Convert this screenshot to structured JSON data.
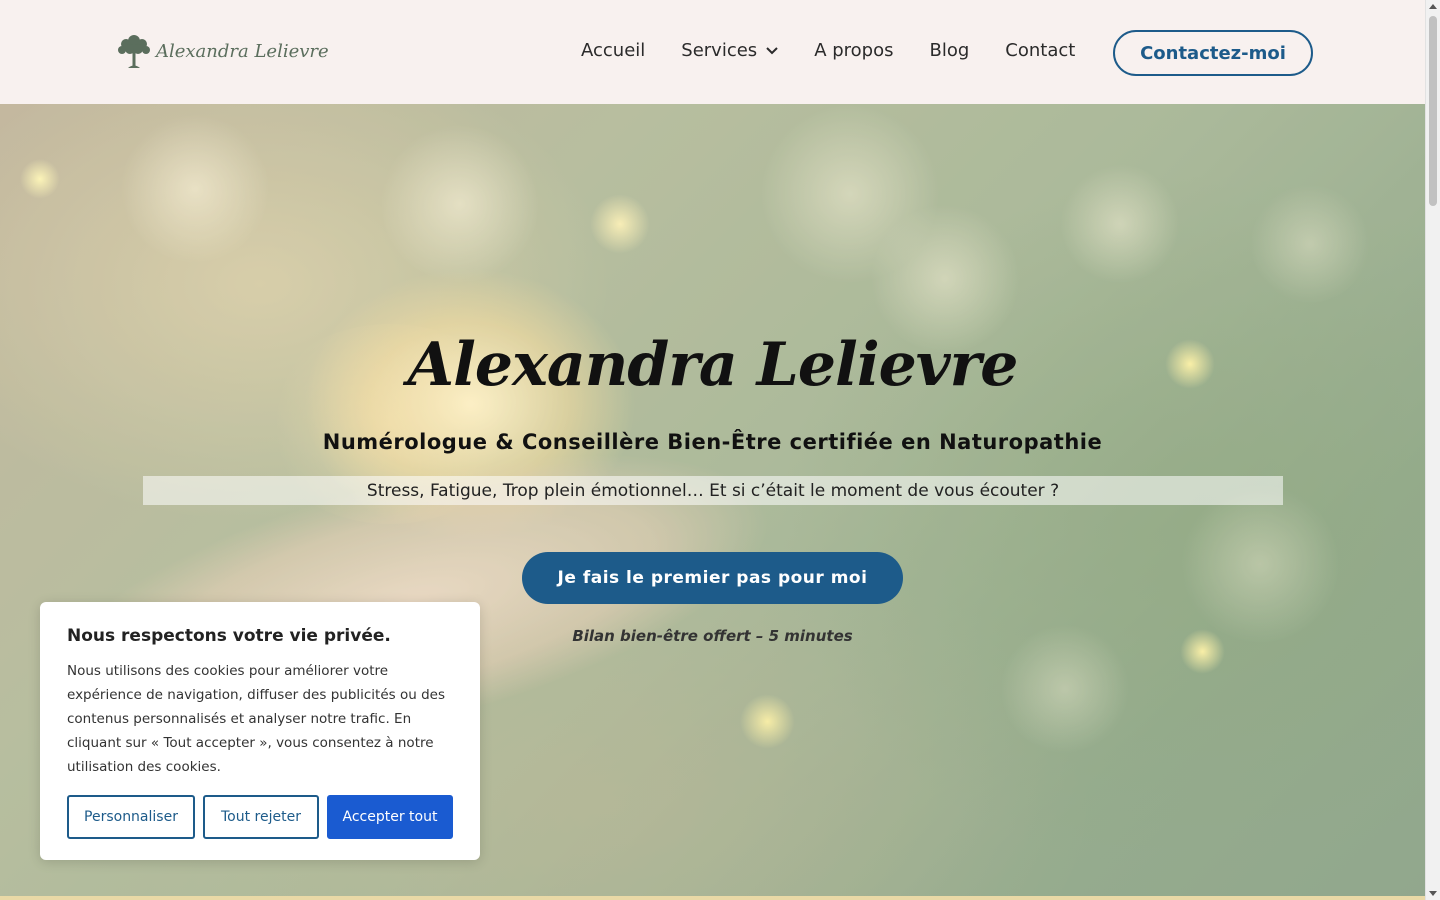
{
  "header": {
    "logo_text": "Alexandra Lelievre",
    "nav": {
      "accueil": "Accueil",
      "services": "Services",
      "apropos": "A propos",
      "blog": "Blog",
      "contact": "Contact"
    },
    "cta_label": "Contactez-moi"
  },
  "hero": {
    "title": "Alexandra Lelievre",
    "subtitle": "Numérologue & Conseillère Bien-Être certifiée en Naturopathie",
    "tagline": "Stress, Fatigue, Trop plein émotionnel… Et si c’était le moment de vous écouter ?",
    "cta_label": "Je fais le premier pas pour moi",
    "note": "Bilan bien-être offert – 5 minutes"
  },
  "cookie": {
    "title": "Nous respectons votre vie privée.",
    "text": "Nous utilisons des cookies pour améliorer votre expérience de navigation, diffuser des publicités ou des contenus personnalisés et analyser notre trafic. En cliquant sur « Tout accepter », vous consentez à notre utilisation des cookies.",
    "personalize": "Personnaliser",
    "reject": "Tout rejeter",
    "accept": "Accepter tout"
  },
  "colors": {
    "brand_blue": "#1d5b8a",
    "accept_blue": "#1a5bd1",
    "header_bg": "#f8f1ef",
    "logo_green": "#5b6e5d"
  },
  "icons": {
    "logo": "tree-icon",
    "services_dropdown": "chevron-down-icon"
  }
}
